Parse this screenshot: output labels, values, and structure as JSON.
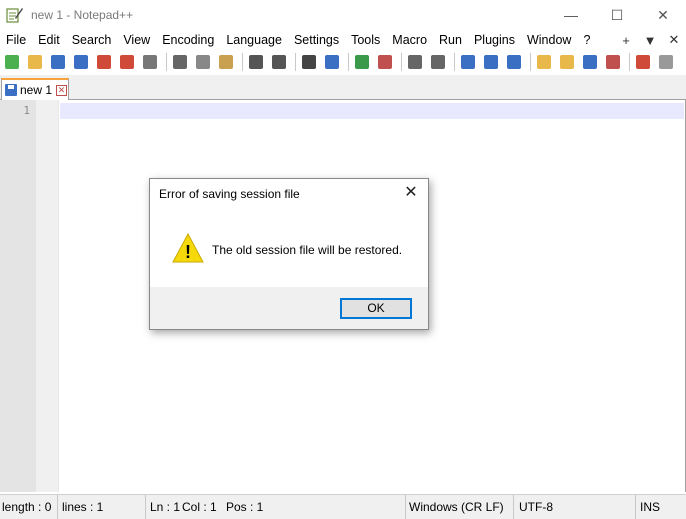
{
  "window": {
    "title": "new 1 - Notepad++",
    "minimize_icon": "—",
    "maximize_icon": "☐",
    "close_icon": "✕"
  },
  "menu": {
    "items": [
      {
        "label": "File"
      },
      {
        "label": "Edit"
      },
      {
        "label": "Search"
      },
      {
        "label": "View"
      },
      {
        "label": "Encoding"
      },
      {
        "label": "Language"
      },
      {
        "label": "Settings"
      },
      {
        "label": "Tools"
      },
      {
        "label": "Macro"
      },
      {
        "label": "Run"
      },
      {
        "label": "Plugins"
      },
      {
        "label": "Window"
      },
      {
        "label": "?"
      }
    ],
    "right_add": "+",
    "right_dropdown": "▼",
    "right_close": "✕"
  },
  "toolbar": {
    "icons": [
      {
        "name": "new-file-icon",
        "color": "#4caf50"
      },
      {
        "name": "open-file-icon",
        "color": "#e8b84a"
      },
      {
        "name": "save-icon",
        "color": "#3a6fc4"
      },
      {
        "name": "save-all-icon",
        "color": "#3a6fc4"
      },
      {
        "name": "close-icon",
        "color": "#d04a3a"
      },
      {
        "name": "close-all-icon",
        "color": "#d04a3a"
      },
      {
        "name": "print-icon",
        "color": "#777777"
      },
      {
        "name": "cut-icon",
        "color": "#666666"
      },
      {
        "name": "copy-icon",
        "color": "#888888"
      },
      {
        "name": "paste-icon",
        "color": "#c8a050"
      },
      {
        "name": "undo-icon",
        "color": "#555555"
      },
      {
        "name": "redo-icon",
        "color": "#555555"
      },
      {
        "name": "find-icon",
        "color": "#444444"
      },
      {
        "name": "replace-icon",
        "color": "#3a6fc4"
      },
      {
        "name": "zoom-in-icon",
        "color": "#3a9a4a"
      },
      {
        "name": "zoom-out-icon",
        "color": "#c0504d"
      },
      {
        "name": "sync-vertical-icon",
        "color": "#666666"
      },
      {
        "name": "sync-horizontal-icon",
        "color": "#666666"
      },
      {
        "name": "word-wrap-icon",
        "color": "#3a6fc4"
      },
      {
        "name": "show-all-chars-icon",
        "color": "#3a6fc4"
      },
      {
        "name": "indent-guide-icon",
        "color": "#3a6fc4"
      },
      {
        "name": "user-language-icon",
        "color": "#e8b84a"
      },
      {
        "name": "document-map-icon",
        "color": "#e8b84a"
      },
      {
        "name": "function-list-icon",
        "color": "#3a6fc4"
      },
      {
        "name": "folder-workspace-icon",
        "color": "#c0504d"
      },
      {
        "name": "record-macro-icon",
        "color": "#d04a3a"
      },
      {
        "name": "stop-macro-icon",
        "color": "#999999"
      }
    ]
  },
  "tabs": [
    {
      "label": "new 1",
      "close": "✕"
    }
  ],
  "editor": {
    "line_numbers": [
      "1"
    ]
  },
  "statusbar": {
    "length": "length : 0",
    "lines": "lines : 1",
    "ln": "Ln : 1",
    "col": "Col : 1",
    "pos": "Pos : 1",
    "eol": "Windows (CR LF)",
    "encoding": "UTF-8",
    "mode": "INS"
  },
  "dialog": {
    "title": "Error of saving session file",
    "close": "✕",
    "message": "The old session file will be restored.",
    "ok_label": "OK",
    "warning_glyph": "!"
  }
}
